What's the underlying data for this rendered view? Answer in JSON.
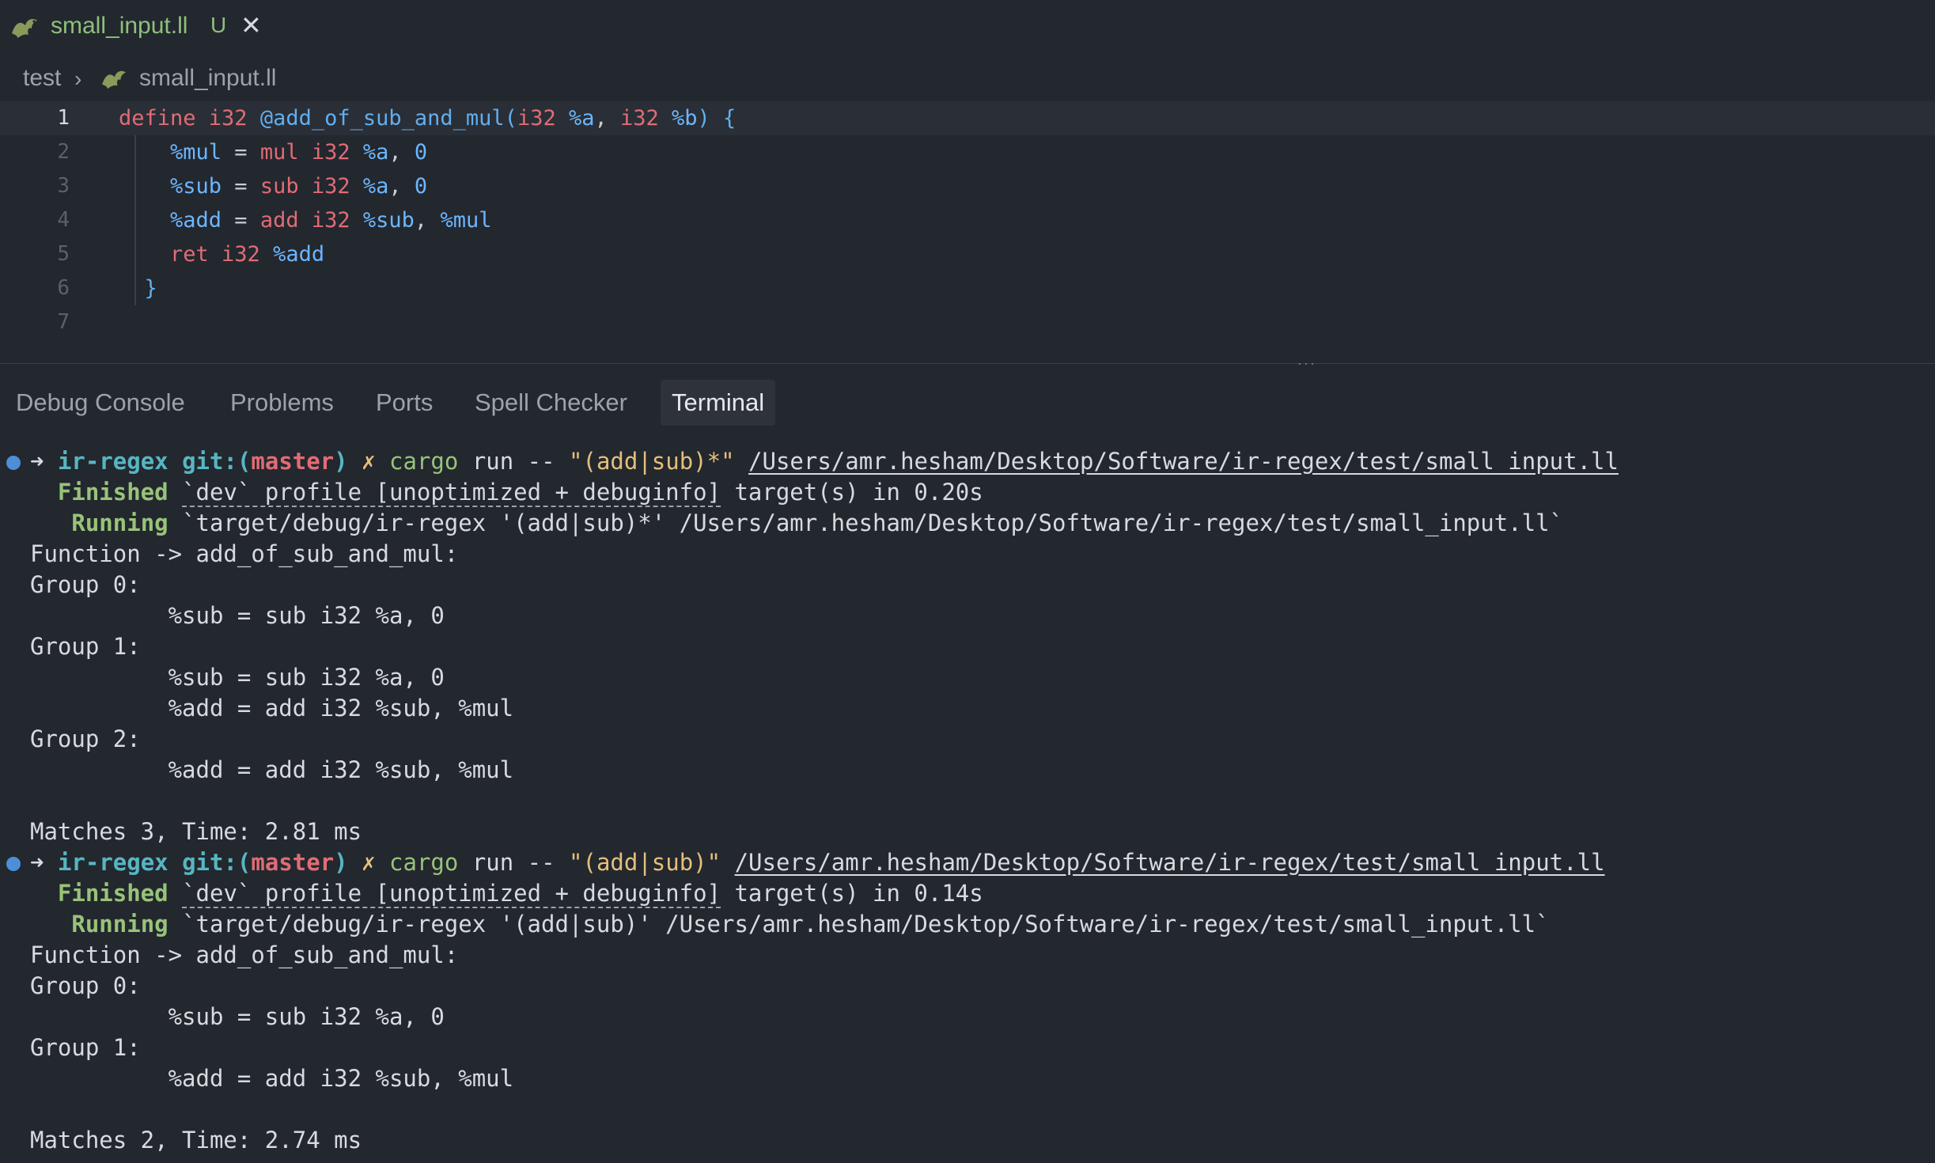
{
  "editor_tab": {
    "filename": "small_input.ll",
    "status_badge": "U",
    "close_glyph": "✕"
  },
  "breadcrumb": {
    "root": "test",
    "separator": "›",
    "file": "small_input.ll"
  },
  "code": {
    "line_numbers": [
      "1",
      "2",
      "3",
      "4",
      "5",
      "6",
      "7"
    ],
    "lines": [
      [
        {
          "t": "define ",
          "c": "kw"
        },
        {
          "t": "i32 ",
          "c": "ty"
        },
        {
          "t": "@add_of_sub_and_mul(",
          "c": "fn"
        },
        {
          "t": "i32 ",
          "c": "ty"
        },
        {
          "t": "%a",
          "c": "var"
        },
        {
          "t": ", ",
          "c": "pun"
        },
        {
          "t": "i32 ",
          "c": "ty"
        },
        {
          "t": "%b",
          "c": "var"
        },
        {
          "t": ") {",
          "c": "brace"
        }
      ],
      [
        {
          "t": "    %mul",
          "c": "var"
        },
        {
          "t": " = ",
          "c": "pun"
        },
        {
          "t": "mul ",
          "c": "kw"
        },
        {
          "t": "i32 ",
          "c": "ty"
        },
        {
          "t": "%a",
          "c": "var"
        },
        {
          "t": ", ",
          "c": "pun"
        },
        {
          "t": "0",
          "c": "num"
        }
      ],
      [
        {
          "t": "    %sub",
          "c": "var"
        },
        {
          "t": " = ",
          "c": "pun"
        },
        {
          "t": "sub ",
          "c": "kw"
        },
        {
          "t": "i32 ",
          "c": "ty"
        },
        {
          "t": "%a",
          "c": "var"
        },
        {
          "t": ", ",
          "c": "pun"
        },
        {
          "t": "0",
          "c": "num"
        }
      ],
      [
        {
          "t": "    %add",
          "c": "var"
        },
        {
          "t": " = ",
          "c": "pun"
        },
        {
          "t": "add ",
          "c": "kw"
        },
        {
          "t": "i32 ",
          "c": "ty"
        },
        {
          "t": "%sub",
          "c": "var"
        },
        {
          "t": ", ",
          "c": "pun"
        },
        {
          "t": "%mul",
          "c": "var"
        }
      ],
      [
        {
          "t": "    ret ",
          "c": "kw"
        },
        {
          "t": "i32 ",
          "c": "ty"
        },
        {
          "t": "%add",
          "c": "var"
        }
      ],
      [
        {
          "t": "  }",
          "c": "brace"
        }
      ],
      []
    ]
  },
  "panel": {
    "tabs": [
      "Debug Console",
      "Problems",
      "Ports",
      "Spell Checker",
      "Terminal"
    ],
    "active_tab": "Terminal"
  },
  "terminal": {
    "runs": [
      {
        "prompt": {
          "arrow": "➜",
          "dir": "ir-regex",
          "git": "git:(",
          "branch": "master",
          "git_close": ")",
          "dirty": "✗",
          "cmd": "cargo",
          "args": " run -- ",
          "pattern": "\"(add|sub)*\"",
          "path": "/Users/amr.hesham/Desktop/Software/ir-regex/test/small_input.ll"
        },
        "finished": {
          "label": "Finished",
          "profile": "`dev` profile [unoptimized + debuginfo]",
          "rest": " target(s) in 0.20s"
        },
        "running": {
          "label": "Running",
          "rest": " `target/debug/ir-regex '(add|sub)*' /Users/amr.hesham/Desktop/Software/ir-regex/test/small_input.ll`"
        },
        "output": [
          "Function -> add_of_sub_and_mul:",
          "Group 0:",
          "          %sub = sub i32 %a, 0",
          "Group 1:",
          "          %sub = sub i32 %a, 0",
          "          %add = add i32 %sub, %mul",
          "Group 2:",
          "          %add = add i32 %sub, %mul",
          "",
          "Matches 3, Time: 2.81 ms"
        ]
      },
      {
        "prompt": {
          "arrow": "➜",
          "dir": "ir-regex",
          "git": "git:(",
          "branch": "master",
          "git_close": ")",
          "dirty": "✗",
          "cmd": "cargo",
          "args": " run -- ",
          "pattern": "\"(add|sub)\"",
          "path": "/Users/amr.hesham/Desktop/Software/ir-regex/test/small_input.ll"
        },
        "finished": {
          "label": "Finished",
          "profile": "`dev` profile [unoptimized + debuginfo]",
          "rest": " target(s) in 0.14s"
        },
        "running": {
          "label": "Running",
          "rest": " `target/debug/ir-regex '(add|sub)' /Users/amr.hesham/Desktop/Software/ir-regex/test/small_input.ll`"
        },
        "output": [
          "Function -> add_of_sub_and_mul:",
          "Group 0:",
          "          %sub = sub i32 %a, 0",
          "Group 1:",
          "          %add = add i32 %sub, %mul",
          "",
          "Matches 2, Time: 2.74 ms"
        ]
      }
    ]
  },
  "colors": {
    "background": "#23272e",
    "accent_green": "#8ec07c",
    "terminal_cyan": "#56b6c2",
    "terminal_red": "#e06c75",
    "terminal_yellow": "#e5c07b",
    "terminal_green": "#98c379",
    "status_dot": "#4d8fd6"
  },
  "icons": [
    "llvm-dragon-icon",
    "close-icon",
    "chevron-right-icon"
  ]
}
